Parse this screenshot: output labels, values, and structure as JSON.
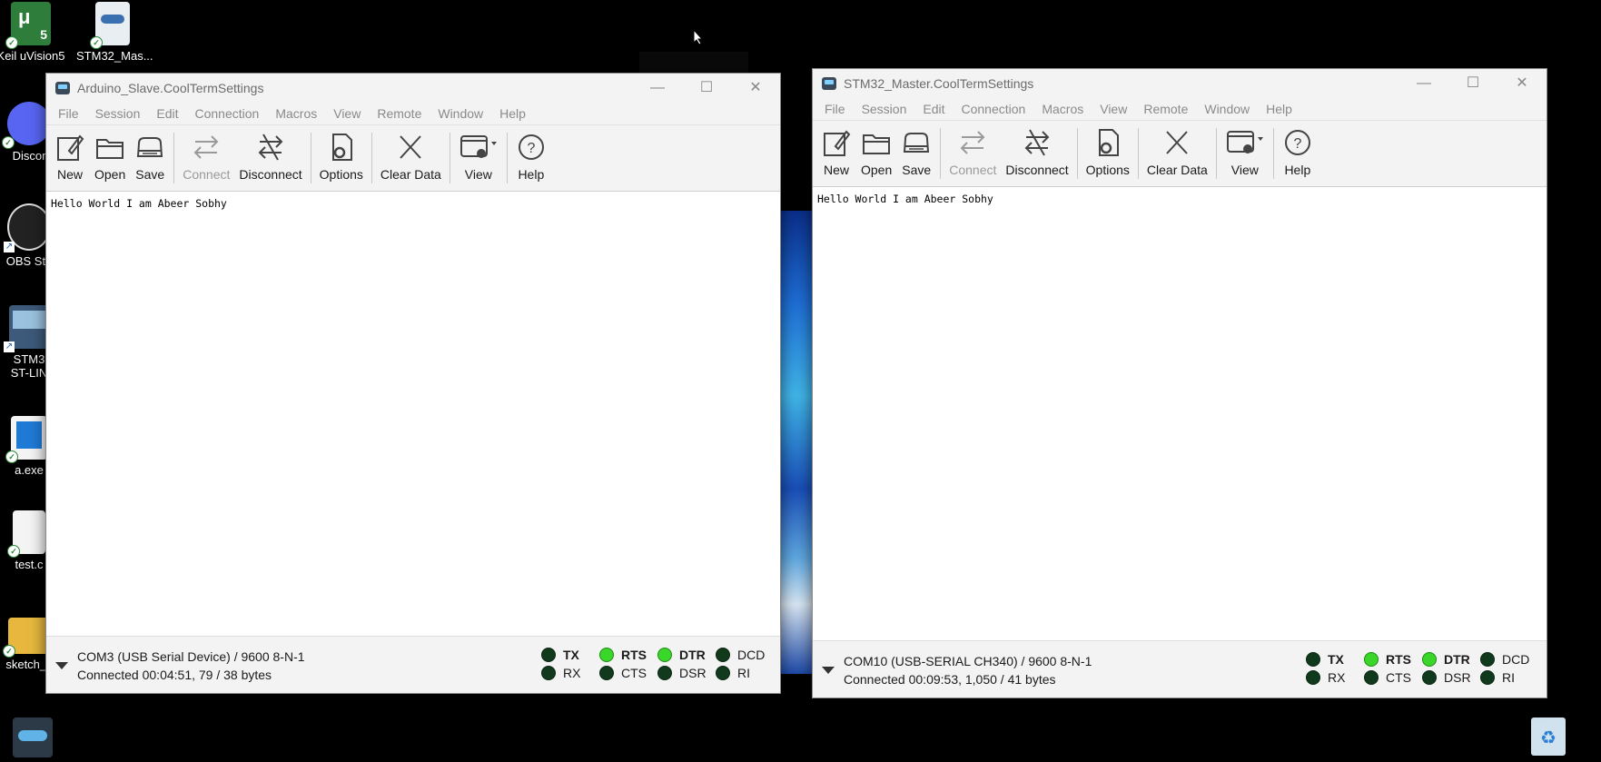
{
  "desktop": {
    "icons": [
      {
        "label": "Keil uVision5"
      },
      {
        "label": "STM32_Mas..."
      },
      {
        "label": "Discor"
      },
      {
        "label": "OBS Stu"
      },
      {
        "label": "STM3"
      },
      {
        "label": "ST-LIN"
      },
      {
        "label": "a.exe"
      },
      {
        "label": "test.c"
      },
      {
        "label": "sketch_c"
      }
    ]
  },
  "windows": [
    {
      "title": "Arduino_Slave.CoolTermSettings",
      "menu": [
        "File",
        "Session",
        "Edit",
        "Connection",
        "Macros",
        "View",
        "Remote",
        "Window",
        "Help"
      ],
      "toolbar": {
        "new": "New",
        "open": "Open",
        "save": "Save",
        "connect": "Connect",
        "disconnect": "Disconnect",
        "options": "Options",
        "clear": "Clear Data",
        "view": "View",
        "help": "Help"
      },
      "terminal_text": "Hello World I am Abeer Sobhy",
      "status": {
        "port": "COM3 (USB Serial Device) / 9600 8-N-1",
        "connection": "Connected 00:04:51, 79 / 38 bytes"
      },
      "leds": [
        {
          "name": "TX",
          "on": false,
          "bold": true
        },
        {
          "name": "RTS",
          "on": true,
          "bold": true
        },
        {
          "name": "DTR",
          "on": true,
          "bold": true
        },
        {
          "name": "DCD",
          "on": false,
          "bold": false
        },
        {
          "name": "RX",
          "on": false,
          "bold": false
        },
        {
          "name": "CTS",
          "on": false,
          "bold": false
        },
        {
          "name": "DSR",
          "on": false,
          "bold": false
        },
        {
          "name": "RI",
          "on": false,
          "bold": false
        }
      ]
    },
    {
      "title": "STM32_Master.CoolTermSettings",
      "menu": [
        "File",
        "Session",
        "Edit",
        "Connection",
        "Macros",
        "View",
        "Remote",
        "Window",
        "Help"
      ],
      "toolbar": {
        "new": "New",
        "open": "Open",
        "save": "Save",
        "connect": "Connect",
        "disconnect": "Disconnect",
        "options": "Options",
        "clear": "Clear Data",
        "view": "View",
        "help": "Help"
      },
      "terminal_text": "Hello World I am Abeer Sobhy",
      "status": {
        "port": "COM10 (USB-SERIAL CH340) / 9600 8-N-1",
        "connection": "Connected 00:09:53, 1,050 / 41 bytes"
      },
      "leds": [
        {
          "name": "TX",
          "on": false,
          "bold": true
        },
        {
          "name": "RTS",
          "on": true,
          "bold": true
        },
        {
          "name": "DTR",
          "on": true,
          "bold": true
        },
        {
          "name": "DCD",
          "on": false,
          "bold": false
        },
        {
          "name": "RX",
          "on": false,
          "bold": false
        },
        {
          "name": "CTS",
          "on": false,
          "bold": false
        },
        {
          "name": "DSR",
          "on": false,
          "bold": false
        },
        {
          "name": "RI",
          "on": false,
          "bold": false
        }
      ]
    }
  ],
  "colors": {
    "led_on": "#3bd62a",
    "led_off": "#113a1c",
    "desktop_bg": "#000000"
  }
}
